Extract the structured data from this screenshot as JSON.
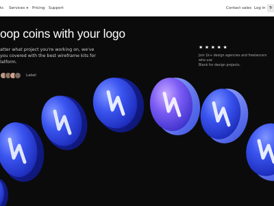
{
  "nav": {
    "items": [
      {
        "label": "ts"
      },
      {
        "label": "Services",
        "has_dropdown": true
      },
      {
        "label": "Pricing"
      },
      {
        "label": "Support"
      }
    ],
    "contact_label": "Contact sales",
    "login_label": "Log in",
    "cta_label": "Tr"
  },
  "hero": {
    "title": "oop coins with your logo",
    "description": "atter what project you're working on, we've\nyou covered with the best wireframe kits for\nlatform.",
    "avatar_label": "Label"
  },
  "testimonial": {
    "stars": "★★★★★",
    "rating": 5,
    "text": "Join 1k+ design agencies and freelancers who use\nBlank for design projects."
  },
  "colors": {
    "nav_bg": "#ffffff",
    "page_bg": "#0b0b0c",
    "coin_blue": "#2a44e6",
    "coin_light": "#6e84ff",
    "coin_purple": "#9b5cff"
  }
}
